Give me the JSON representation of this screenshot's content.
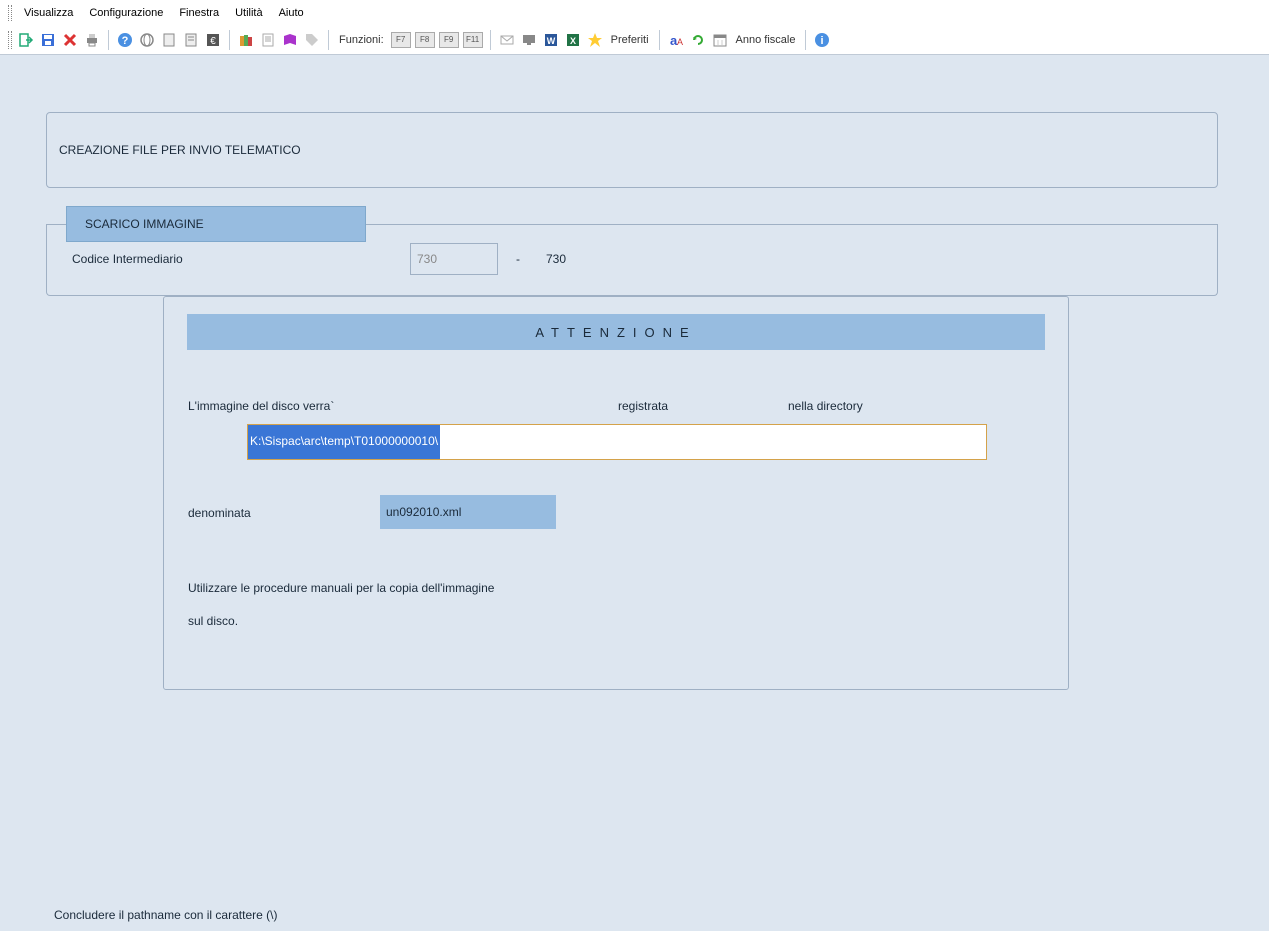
{
  "menu": {
    "visualizza": "Visualizza",
    "configurazione": "Configurazione",
    "finestra": "Finestra",
    "utilita": "Utilità",
    "aiuto": "Aiuto"
  },
  "toolbar": {
    "funzioni": "Funzioni:",
    "f7": "F7",
    "f8": "F8",
    "f9": "F9",
    "f11": "F11",
    "preferiti": "Preferiti",
    "anno_fiscale": "Anno fiscale"
  },
  "panel": {
    "title": "CREAZIONE FILE PER INVIO TELEMATICO",
    "tab": "SCARICO IMMAGINE",
    "codice_label": "Codice Intermediario",
    "codice_val1": "730",
    "dash": "-",
    "codice_val2": "730"
  },
  "attn": {
    "header": "ATTENZIONE",
    "line1a": "L'immagine del disco verra`",
    "line1b": "registrata",
    "line1c": "nella directory",
    "path": "K:\\Sispac\\arc\\temp\\T01000000010\\",
    "denominata": "denominata",
    "filename": "un092010.xml",
    "line3": "Utilizzare le procedure manuali per la copia dell'immagine",
    "line4": "sul disco."
  },
  "footer": "Concludere il pathname con il carattere (\\)"
}
